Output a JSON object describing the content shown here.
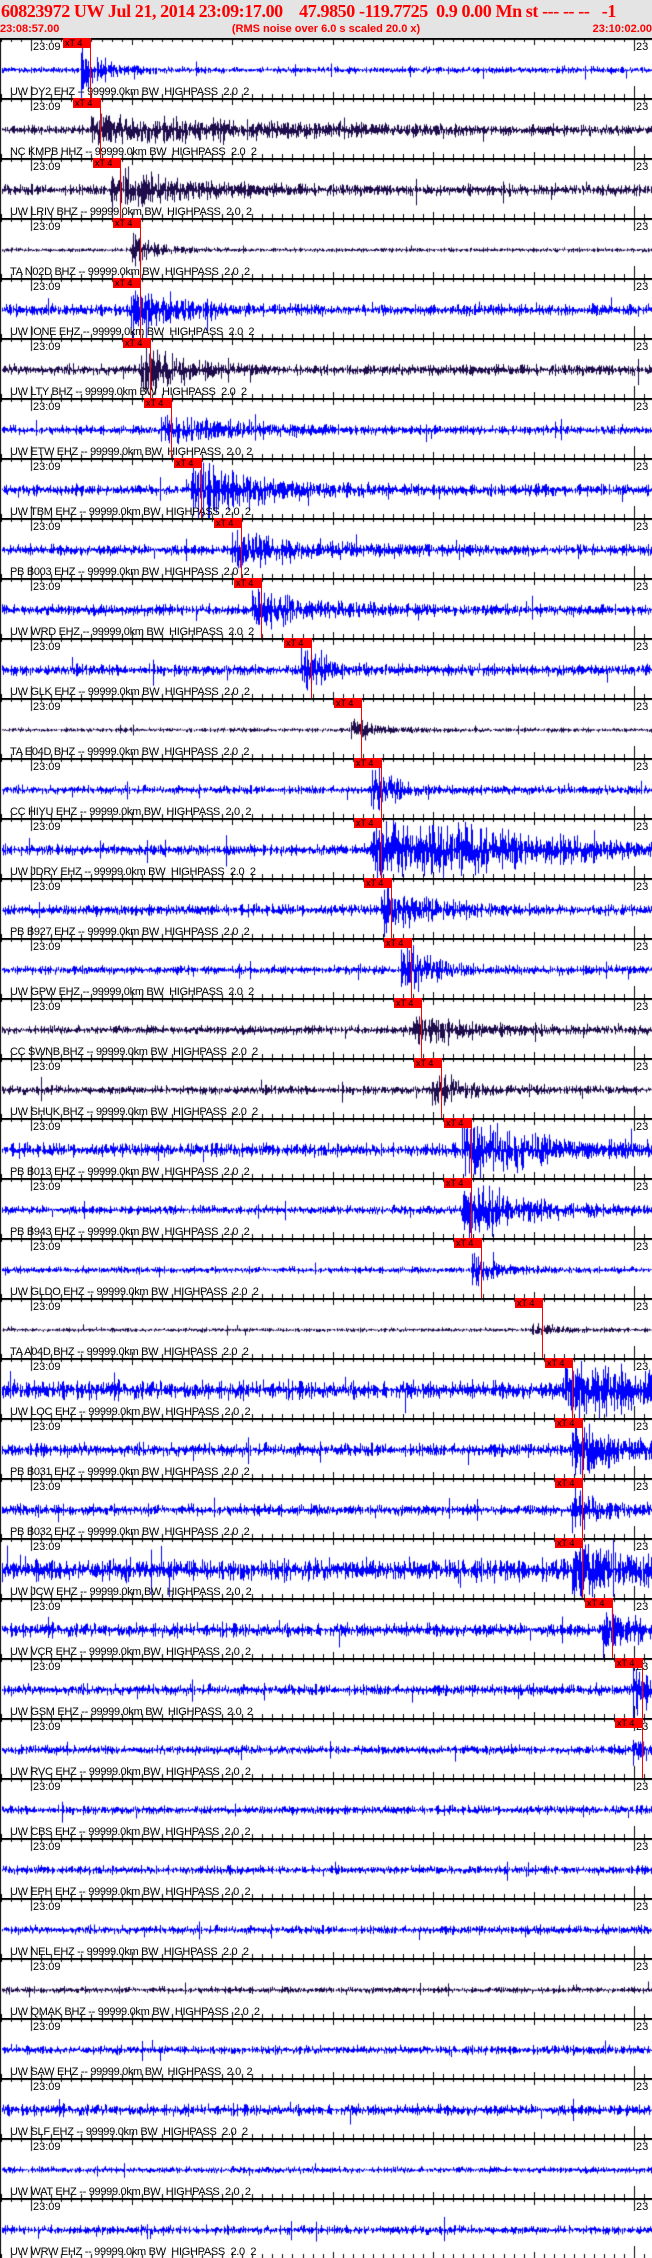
{
  "header": {
    "title": "60823972 UW Jul 21, 2014 23:09:17.00    47.9850 -119.7725  0.9 0.00 Mn st --- -- --   -1",
    "start_time": "23:08:57.00",
    "note": "(RMS noise over 6.0 s scaled 20.0 x)",
    "end_time": "23:10:02.00"
  },
  "axis": {
    "start_label": "23:09",
    "end_label": "23",
    "span_s": 65,
    "first_major_s": 3
  },
  "pick_label": "xT 4",
  "colors": {
    "short_period": "#0000ff",
    "broadband": "#1e0c4c",
    "pick": "#ff0000",
    "title": "#ff0000"
  },
  "filter_suffix": " -- 99999.0km BW  HIGHPASS  2.0  2",
  "traces": [
    {
      "station": "UW DY2 EHZ",
      "pick_s": 8.9,
      "noise": 3,
      "burst": 22,
      "dur": 2
    },
    {
      "station": "NC KMPB HHZ",
      "pick_s": 9.9,
      "noise": 4,
      "burst": 12,
      "dur": 20
    },
    {
      "station": "UW LRIV BHZ",
      "pick_s": 11.8,
      "noise": 5,
      "burst": 20,
      "dur": 6
    },
    {
      "station": "TA N02D BHZ",
      "pick_s": 13.8,
      "noise": 2,
      "burst": 20,
      "dur": 2
    },
    {
      "station": "UW IONE EHZ",
      "pick_s": 13.8,
      "noise": 5,
      "burst": 25,
      "dur": 4
    },
    {
      "station": "UW LTY BHZ",
      "pick_s": 14.8,
      "noise": 5,
      "burst": 28,
      "dur": 3
    },
    {
      "station": "UW ETW EHZ",
      "pick_s": 16.9,
      "noise": 4,
      "burst": 12,
      "dur": 8
    },
    {
      "station": "UW TBM EHZ",
      "pick_s": 19.9,
      "noise": 5,
      "burst": 25,
      "dur": 6
    },
    {
      "station": "PB B003 EHZ",
      "pick_s": 23.9,
      "noise": 5,
      "burst": 14,
      "dur": 8
    },
    {
      "station": "UW WRD EHZ",
      "pick_s": 25.9,
      "noise": 5,
      "burst": 14,
      "dur": 6
    },
    {
      "station": "UW GLK EHZ",
      "pick_s": 30.8,
      "noise": 5,
      "burst": 25,
      "dur": 2
    },
    {
      "station": "TA E04D BHZ",
      "pick_s": 35.8,
      "noise": 2,
      "burst": 10,
      "dur": 3
    },
    {
      "station": "CC HIYU EHZ",
      "pick_s": 37.8,
      "noise": 4,
      "burst": 25,
      "dur": 2
    },
    {
      "station": "UW JDRY EHZ",
      "pick_s": 37.8,
      "noise": 5,
      "burst": 40,
      "dur": 12
    },
    {
      "station": "PB B927 EHZ",
      "pick_s": 38.8,
      "noise": 5,
      "burst": 20,
      "dur": 4
    },
    {
      "station": "UW GPW EHZ",
      "pick_s": 40.8,
      "noise": 4,
      "burst": 25,
      "dur": 3
    },
    {
      "station": "CC SWNB BHZ",
      "pick_s": 41.8,
      "noise": 4,
      "burst": 12,
      "dur": 6
    },
    {
      "station": "UW SHUK BHZ",
      "pick_s": 43.8,
      "noise": 4,
      "burst": 18,
      "dur": 3
    },
    {
      "station": "PB B013 EHZ",
      "pick_s": 46.8,
      "noise": 6,
      "burst": 25,
      "dur": 8
    },
    {
      "station": "PB B943 EHZ",
      "pick_s": 46.8,
      "noise": 4,
      "burst": 25,
      "dur": 6
    },
    {
      "station": "UW GLDO EHZ",
      "pick_s": 47.8,
      "noise": 3,
      "burst": 18,
      "dur": 2
    },
    {
      "station": "TA A04D BHZ",
      "pick_s": 53.8,
      "noise": 2,
      "burst": 5,
      "dur": 3
    },
    {
      "station": "UW LOC EHZ",
      "pick_s": 56.8,
      "noise": 8,
      "burst": 28,
      "dur": 8
    },
    {
      "station": "PB B031 EHZ",
      "pick_s": 57.8,
      "noise": 6,
      "burst": 26,
      "dur": 4
    },
    {
      "station": "PB B032 EHZ",
      "pick_s": 57.8,
      "noise": 5,
      "burst": 18,
      "dur": 3
    },
    {
      "station": "UW JCW EHZ",
      "pick_s": 57.8,
      "noise": 10,
      "burst": 25,
      "dur": 4
    },
    {
      "station": "UW VCR EHZ",
      "pick_s": 60.8,
      "noise": 6,
      "burst": 20,
      "dur": 3
    },
    {
      "station": "UW GSM EHZ",
      "pick_s": 63.8,
      "noise": 5,
      "burst": 20,
      "dur": 3
    },
    {
      "station": "UW RVC EHZ",
      "pick_s": 63.8,
      "noise": 4,
      "burst": 8,
      "dur": 2
    },
    {
      "station": "UW CBS EHZ",
      "noise": 4
    },
    {
      "station": "UW EPH EHZ",
      "noise": 4
    },
    {
      "station": "UW NEL EHZ",
      "noise": 4
    },
    {
      "station": "UW QMAK BHZ",
      "noise": 3
    },
    {
      "station": "UW SAW EHZ",
      "noise": 4
    },
    {
      "station": "UW SLF EHZ",
      "noise": 5
    },
    {
      "station": "UW WAT EHZ",
      "noise": 3
    },
    {
      "station": "UW WRW EHZ",
      "noise": 4
    }
  ]
}
